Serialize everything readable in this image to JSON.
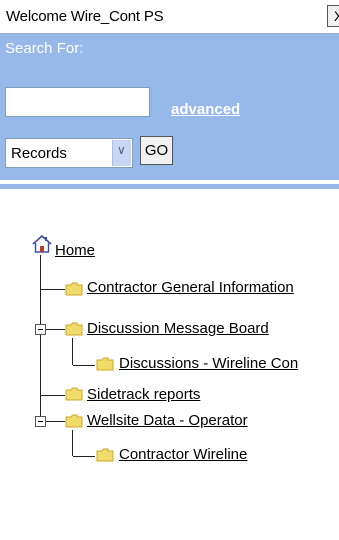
{
  "header": {
    "welcome_text": "Welcome Wire_Cont PS",
    "close_label": "X"
  },
  "search": {
    "label": "Search For:",
    "input_value": "",
    "advanced_label": "advanced",
    "scope_selected": "Records",
    "go_label": "GO"
  },
  "tree": {
    "home_label": "Home",
    "items": [
      {
        "label": "Contractor General Information"
      },
      {
        "label": "Discussion Message Board"
      },
      {
        "label": "Discussions - Wireline Con"
      },
      {
        "label": "Sidetrack reports"
      },
      {
        "label": "Wellsite Data - Operator"
      },
      {
        "label": "Contractor Wireline"
      }
    ]
  },
  "colors": {
    "panel_blue": "#96b9ea",
    "folder_yellow": "#f1db6a"
  },
  "icons": [
    "home-icon",
    "folder-icon",
    "collapse-icon",
    "dropdown-arrow-icon"
  ]
}
